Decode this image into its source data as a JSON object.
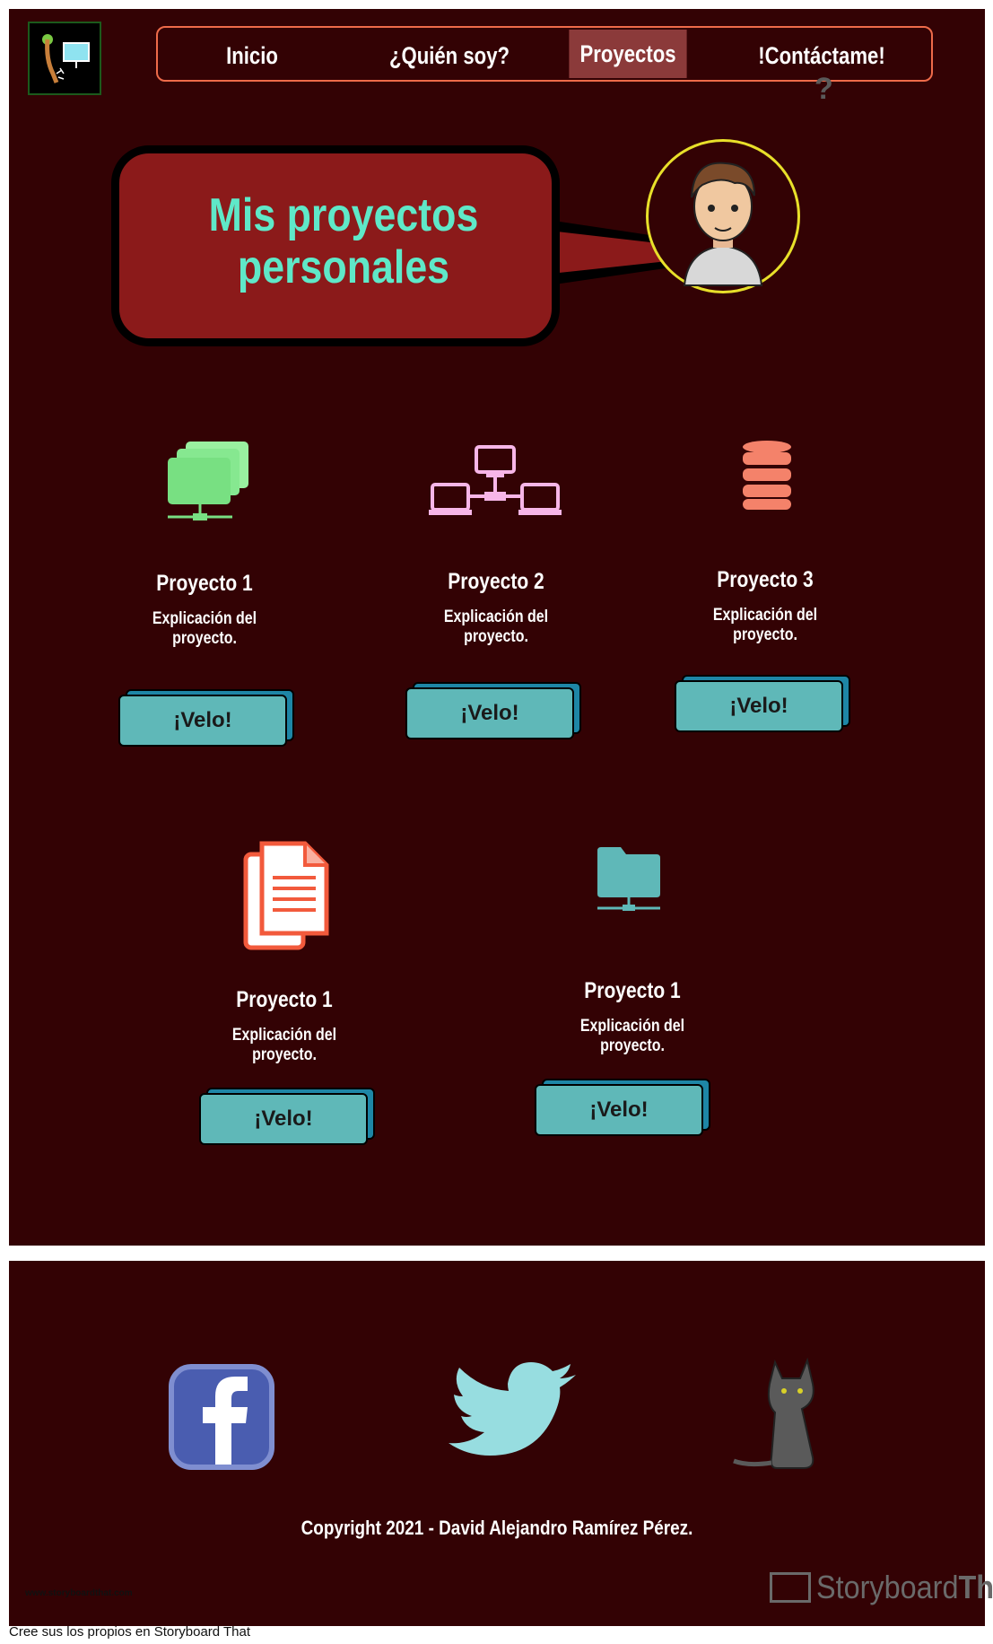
{
  "nav": {
    "items": [
      "Inicio",
      "¿Quién soy?",
      "Proyectos",
      "!Contáctame!"
    ],
    "active_index": 2,
    "question_mark": "?"
  },
  "hero": {
    "title_line1": "Mis proyectos",
    "title_line2": "personales"
  },
  "projects": [
    {
      "title": "Proyecto 1",
      "desc_line1": "Explicación del",
      "desc_line2": "proyecto.",
      "button": "¡Velo!",
      "icon": "folders-network-icon"
    },
    {
      "title": "Proyecto 2",
      "desc_line1": "Explicación del",
      "desc_line2": "proyecto.",
      "button": "¡Velo!",
      "icon": "network-icon"
    },
    {
      "title": "Proyecto 3",
      "desc_line1": "Explicación del",
      "desc_line2": "proyecto.",
      "button": "¡Velo!",
      "icon": "database-icon"
    },
    {
      "title": "Proyecto 1",
      "desc_line1": "Explicación del",
      "desc_line2": "proyecto.",
      "button": "¡Velo!",
      "icon": "documents-icon"
    },
    {
      "title": "Proyecto 1",
      "desc_line1": "Explicación del",
      "desc_line2": "proyecto.",
      "button": "¡Velo!",
      "icon": "folder-network-icon"
    }
  ],
  "footer": {
    "copyright": "Copyright 2021 - David Alejandro Ramírez Pérez.",
    "social": [
      "facebook-icon",
      "twitter-icon",
      "cat-icon"
    ],
    "url": "www.storyboardthat.com",
    "brand_light": "Storyboard",
    "brand_bold": "That",
    "note": "Cree sus los propios en Storyboard That"
  },
  "colors": {
    "background": "#330204",
    "nav_border": "#ee6b4a",
    "active_tab": "#8b3a3a",
    "bubble": "#8b1a1a",
    "bubble_text": "#5fe8c8",
    "button": "#5fb8b8"
  }
}
